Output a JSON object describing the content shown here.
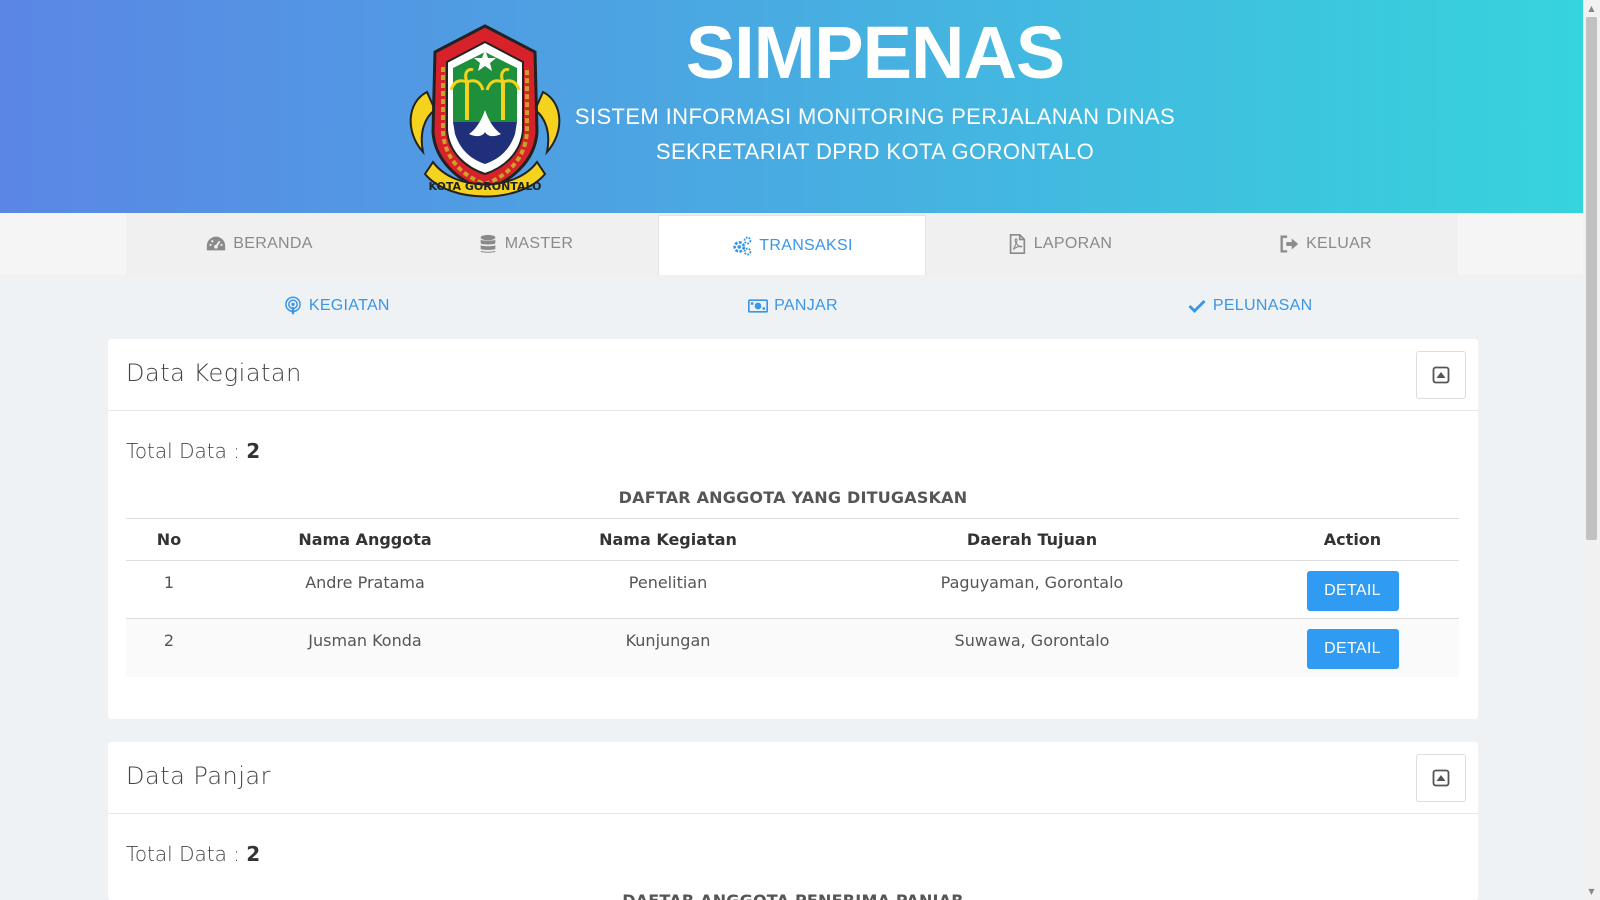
{
  "header": {
    "title": "SIMPENAS",
    "subtitle_line1": "SISTEM INFORMASI MONITORING PERJALANAN DINAS",
    "subtitle_line2": "SEKRETARIAT DPRD KOTA GORONTALO",
    "logo_text": "KOTA GORONTALO"
  },
  "nav": {
    "items": [
      {
        "label": "BERANDA",
        "icon": "dashboard-icon"
      },
      {
        "label": "MASTER",
        "icon": "database-icon"
      },
      {
        "label": "TRANSAKSI",
        "icon": "cogs-icon",
        "active": true
      },
      {
        "label": "LAPORAN",
        "icon": "file-pdf-icon"
      },
      {
        "label": "KELUAR",
        "icon": "sign-out-icon"
      }
    ]
  },
  "subnav": {
    "items": [
      {
        "label": "KEGIATAN",
        "icon": "podcast-icon"
      },
      {
        "label": "PANJAR",
        "icon": "money-icon"
      },
      {
        "label": "PELUNASAN",
        "icon": "check-icon"
      }
    ]
  },
  "kegiatan": {
    "title": "Data Kegiatan",
    "total_label": "Total Data : ",
    "total_value": "2",
    "list_title": "DAFTAR ANGGOTA YANG DITUGASKAN",
    "columns": [
      "No",
      "Nama Anggota",
      "Nama Kegiatan",
      "Daerah Tujuan",
      "Action"
    ],
    "rows": [
      {
        "no": "1",
        "nama": "Andre Pratama",
        "kegiatan": "Penelitian",
        "tujuan": "Paguyaman, Gorontalo",
        "action": "DETAIL"
      },
      {
        "no": "2",
        "nama": "Jusman Konda",
        "kegiatan": "Kunjungan",
        "tujuan": "Suwawa, Gorontalo",
        "action": "DETAIL"
      }
    ]
  },
  "panjar": {
    "title": "Data Panjar",
    "total_label": "Total Data : ",
    "total_value": "2",
    "list_title": "DAFTAR ANGGOTA PENERIMA PANJAR"
  },
  "colors": {
    "accent": "#3a96e6",
    "button": "#2f9bf3",
    "header_start": "#5b86e5",
    "header_end": "#36d4dc"
  }
}
